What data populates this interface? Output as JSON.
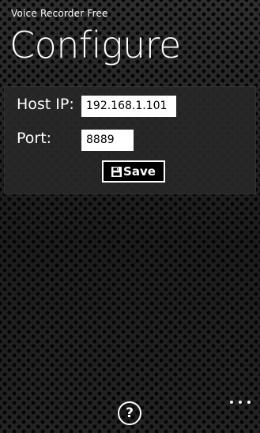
{
  "app": {
    "title": "Voice Recorder Free"
  },
  "page": {
    "title": "Configure"
  },
  "form": {
    "host_ip": {
      "label": "Host IP:",
      "value": "192.168.1.101"
    },
    "port": {
      "label": "Port:",
      "value": "8889"
    },
    "save_button": {
      "label": "Save",
      "icon": "save-icon"
    }
  },
  "app_bar": {
    "help_icon": "help-icon",
    "help_glyph": "?",
    "more_icon": "ellipsis-icon"
  },
  "colors": {
    "text": "#ffffff",
    "panel": "#282828",
    "input_background": "#ffffff",
    "input_text": "#000000",
    "button_background": "#000000"
  }
}
